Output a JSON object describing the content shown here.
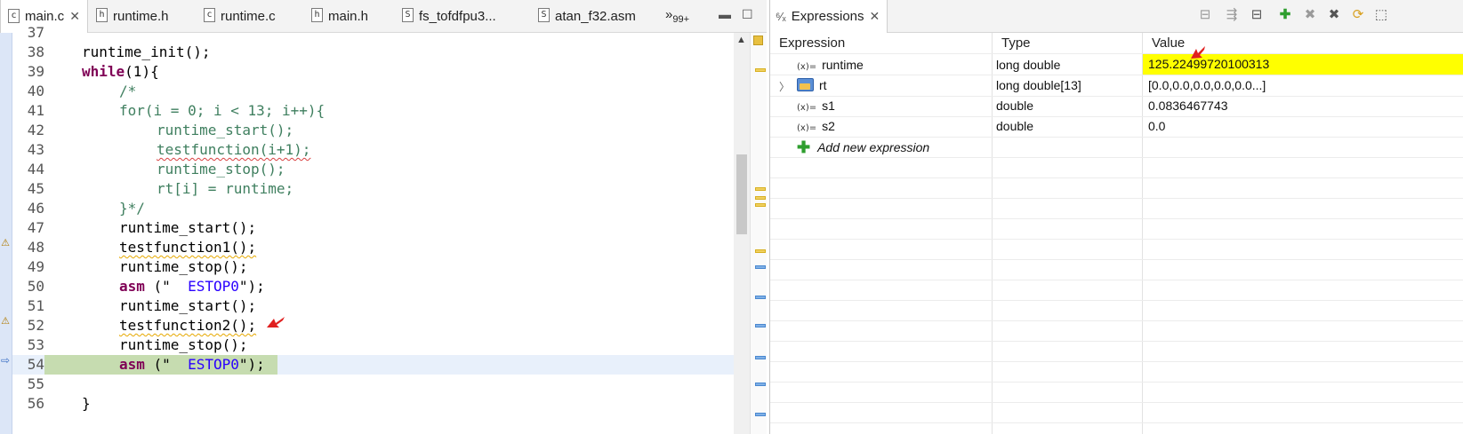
{
  "editor": {
    "tabs": [
      {
        "icon": "c",
        "label": "main.c",
        "closable": true
      },
      {
        "icon": "h",
        "label": "runtime.h"
      },
      {
        "icon": "c",
        "label": "runtime.c"
      },
      {
        "icon": "h",
        "label": "main.h"
      },
      {
        "icon": "S",
        "label": "fs_tofdfpu3..."
      },
      {
        "icon": "S",
        "label": "atan_f32.asm"
      }
    ],
    "overflow_label": "»",
    "overflow_count": "99+",
    "lines": [
      {
        "n": "37"
      },
      {
        "n": "38",
        "code": "runtime_init();"
      },
      {
        "n": "39",
        "kw": "while",
        "code": "(1){"
      },
      {
        "n": "40",
        "comment": "/*"
      },
      {
        "n": "41",
        "comment": "for(i = 0; i < 13; i++){"
      },
      {
        "n": "42",
        "comment": "runtime_start();"
      },
      {
        "n": "43",
        "comment": "testfunction(i+1);"
      },
      {
        "n": "44",
        "comment": "runtime_stop();"
      },
      {
        "n": "45",
        "comment": "rt[i] = runtime;"
      },
      {
        "n": "46",
        "comment": "}*/"
      },
      {
        "n": "47",
        "code": "runtime_start();"
      },
      {
        "n": "48",
        "code": "testfunction1();"
      },
      {
        "n": "49",
        "code": "runtime_stop();"
      },
      {
        "n": "50",
        "kw": "asm",
        "pre": " (\"",
        "str": "  ESTOP0",
        "post": "\");"
      },
      {
        "n": "51",
        "code": "runtime_start();"
      },
      {
        "n": "52",
        "code": "testfunction2();"
      },
      {
        "n": "53",
        "code": "runtime_stop();"
      },
      {
        "n": "54",
        "kw": "asm",
        "pre": " (\"",
        "str": "  ESTOP0",
        "post": "\");"
      },
      {
        "n": "55"
      },
      {
        "n": "56",
        "code": "}"
      }
    ]
  },
  "expressions": {
    "tab_label": "Expressions",
    "columns": {
      "expression": "Expression",
      "type": "Type",
      "value": "Value"
    },
    "rows": [
      {
        "name": "runtime",
        "type": "long double",
        "value": "125.22499720100313",
        "highlight_color": "#ffff00"
      },
      {
        "name": "rt",
        "type": "long double[13]",
        "value": "[0.0,0.0,0.0,0.0,0.0...]"
      },
      {
        "name": "s1",
        "type": "double",
        "value": "0.0836467743"
      },
      {
        "name": "s2",
        "type": "double",
        "value": "0.0"
      }
    ],
    "add_label": "Add new expression",
    "var_icon": "(x)="
  }
}
